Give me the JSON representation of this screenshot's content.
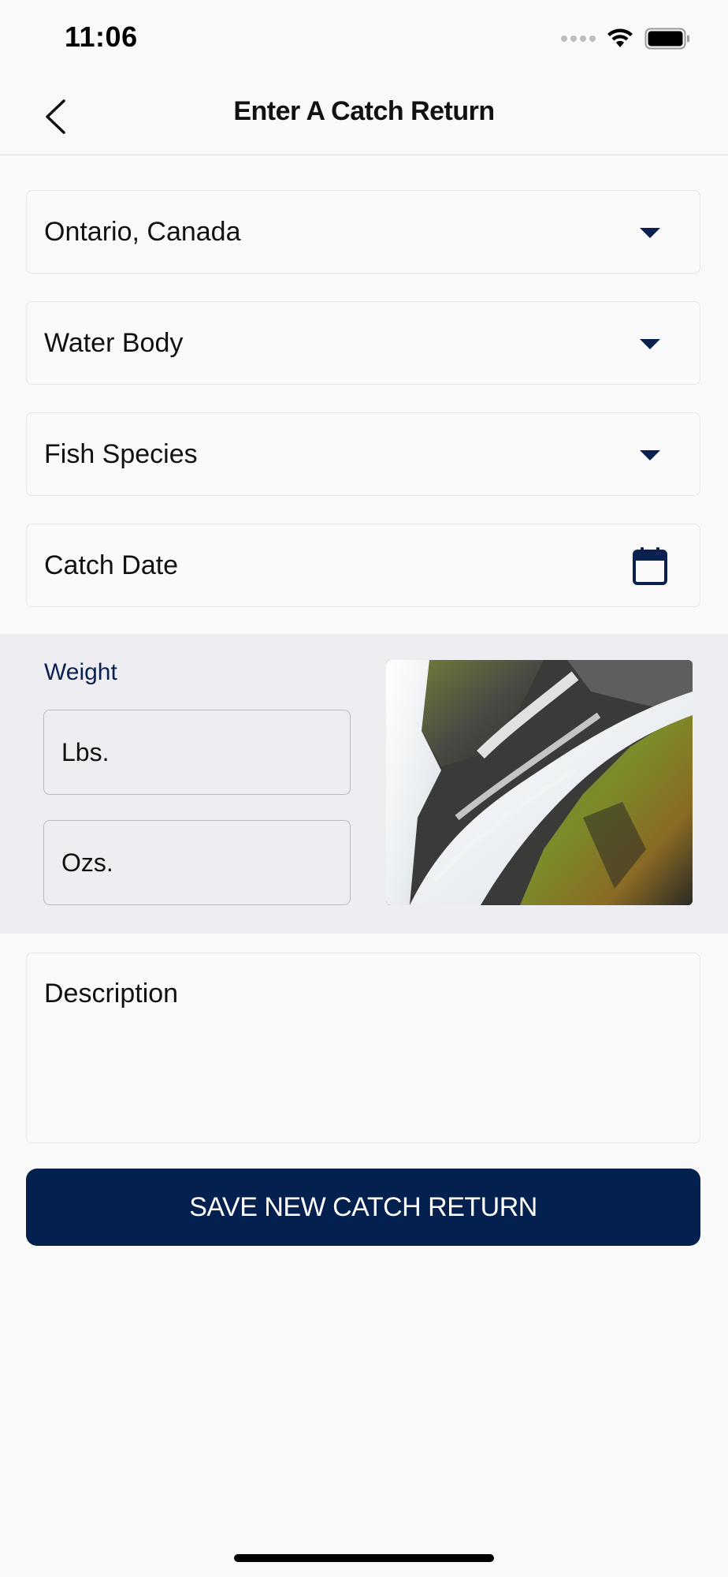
{
  "status_bar": {
    "time": "11:06",
    "icons": [
      "signal-icon",
      "wifi-icon",
      "battery-icon"
    ]
  },
  "header": {
    "title": "Enter A Catch Return",
    "back_icon": "chevron-left-icon"
  },
  "form": {
    "region": {
      "value": "Ontario, Canada",
      "icon": "caret-down-icon"
    },
    "water_body": {
      "value": "Water Body",
      "icon": "caret-down-icon"
    },
    "fish_species": {
      "value": "Fish Species",
      "icon": "caret-down-icon"
    },
    "catch_date": {
      "value": "Catch Date",
      "icon": "calendar-icon"
    },
    "weight": {
      "label": "Weight",
      "lbs_placeholder": "Lbs.",
      "ozs_placeholder": "Ozs."
    },
    "photo": {
      "icon": "waterfall-photo"
    },
    "description": {
      "placeholder": "Description"
    }
  },
  "actions": {
    "save_label": "SAVE NEW CATCH RETURN"
  },
  "colors": {
    "brand_navy": "#04204f",
    "accent_navy": "#0a2150",
    "background": "#f9f9f9",
    "weight_band": "#eeeef2"
  }
}
